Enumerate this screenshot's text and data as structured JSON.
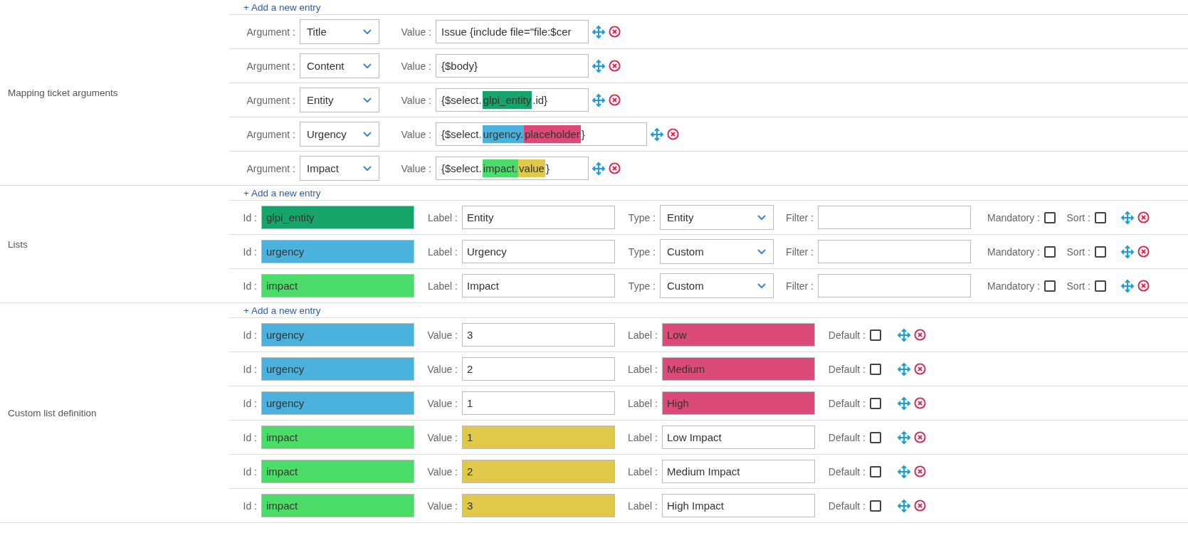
{
  "mapping": {
    "add_link": "+ Add a new entry",
    "label": "Mapping ticket arguments",
    "rows": [
      {
        "argument_label": "Argument :",
        "argument": "Title",
        "value_label": "Value :",
        "value": [
          {
            "text": "Issue {include file=\"file:$cer"
          }
        ]
      },
      {
        "argument_label": "Argument :",
        "argument": "Content",
        "value_label": "Value :",
        "value": [
          {
            "text": "{$body}"
          }
        ]
      },
      {
        "argument_label": "Argument :",
        "argument": "Entity",
        "value_label": "Value :",
        "value": [
          {
            "text": "{$select."
          },
          {
            "text": "glpi_entity",
            "color": "#16a46a"
          },
          {
            "text": ".id}"
          }
        ]
      },
      {
        "argument_label": "Argument :",
        "argument": "Urgency",
        "value_label": "Value :",
        "wide": true,
        "value": [
          {
            "text": "{$select."
          },
          {
            "text": "urgency.",
            "color": "#4ab2dd"
          },
          {
            "text": "placeholder",
            "color": "#dc4a7a"
          },
          {
            "text": "}"
          }
        ]
      },
      {
        "argument_label": "Argument :",
        "argument": "Impact",
        "value_label": "Value :",
        "value": [
          {
            "text": "{$select."
          },
          {
            "text": "impact.",
            "color": "#4cdc6a"
          },
          {
            "text": "value",
            "color": "#dfc84a"
          },
          {
            "text": "}"
          }
        ]
      }
    ]
  },
  "lists": {
    "add_link": "+ Add a new entry",
    "label": "Lists",
    "rows": [
      {
        "id_label": "Id :",
        "id": "glpi_entity",
        "color": "#16a46a",
        "label_label": "Label :",
        "label": "Entity",
        "type_label": "Type :",
        "type": "Entity",
        "filter_label": "Filter :",
        "mandatory_label": "Mandatory :",
        "mandatory": false,
        "sort_label": "Sort :",
        "sort": false
      },
      {
        "id_label": "Id :",
        "id": "urgency",
        "color": "#4ab2dd",
        "label_label": "Label :",
        "label": "Urgency",
        "type_label": "Type :",
        "type": "Custom",
        "filter_label": "Filter :",
        "mandatory_label": "Mandatory :",
        "mandatory": false,
        "sort_label": "Sort :",
        "sort": false
      },
      {
        "id_label": "Id :",
        "id": "impact",
        "color": "#4cdc6a",
        "label_label": "Label :",
        "label": "Impact",
        "type_label": "Type :",
        "type": "Custom",
        "filter_label": "Filter :",
        "mandatory_label": "Mandatory :",
        "mandatory": false,
        "sort_label": "Sort :",
        "sort": false
      }
    ]
  },
  "custom": {
    "add_link": "+ Add a new entry",
    "label": "Custom list definition",
    "rows": [
      {
        "id_label": "Id :",
        "id": {
          "text": "urgency",
          "color": "#4ab2dd"
        },
        "value_label": "Value :",
        "value": {
          "text": "3"
        },
        "label_label": "Label :",
        "label": {
          "text": "Low",
          "color": "#dc4a7a"
        },
        "default_label": "Default :",
        "default": false
      },
      {
        "id_label": "Id :",
        "id": {
          "text": "urgency",
          "color": "#4ab2dd"
        },
        "value_label": "Value :",
        "value": {
          "text": "2"
        },
        "label_label": "Label :",
        "label": {
          "text": "Medium",
          "color": "#dc4a7a"
        },
        "default_label": "Default :",
        "default": false
      },
      {
        "id_label": "Id :",
        "id": {
          "text": "urgency",
          "color": "#4ab2dd"
        },
        "value_label": "Value :",
        "value": {
          "text": "1"
        },
        "label_label": "Label :",
        "label": {
          "text": "High",
          "color": "#dc4a7a"
        },
        "default_label": "Default :",
        "default": false
      },
      {
        "id_label": "Id :",
        "id": {
          "text": "impact",
          "color": "#4cdc6a"
        },
        "value_label": "Value :",
        "value": {
          "text": "1",
          "color": "#dfc84a"
        },
        "label_label": "Label :",
        "label": {
          "text": "Low Impact"
        },
        "default_label": "Default :",
        "default": false
      },
      {
        "id_label": "Id :",
        "id": {
          "text": "impact",
          "color": "#4cdc6a"
        },
        "value_label": "Value :",
        "value": {
          "text": "2",
          "color": "#dfc84a"
        },
        "label_label": "Label :",
        "label": {
          "text": "Medium Impact"
        },
        "default_label": "Default :",
        "default": false
      },
      {
        "id_label": "Id :",
        "id": {
          "text": "impact",
          "color": "#4cdc6a"
        },
        "value_label": "Value :",
        "value": {
          "text": "3",
          "color": "#dfc84a"
        },
        "label_label": "Label :",
        "label": {
          "text": "High Impact"
        },
        "default_label": "Default :",
        "default": false
      }
    ]
  }
}
